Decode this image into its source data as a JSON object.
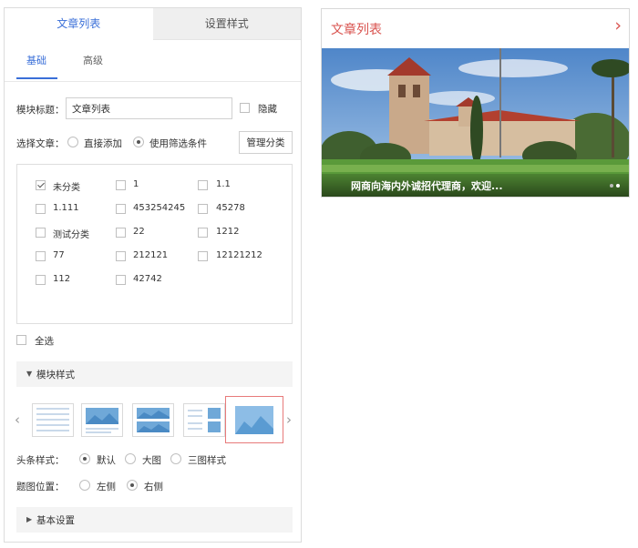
{
  "top_tabs": {
    "list": "文章列表",
    "style": "设置样式"
  },
  "sub_tabs": {
    "basic": "基础",
    "advanced": "高级"
  },
  "module_title": {
    "label": "模块标题：",
    "value": "文章列表",
    "hide_label": "隐藏"
  },
  "select_article": {
    "label": "选择文章：",
    "option_direct": "直接添加",
    "option_filter": "使用筛选条件",
    "manage_button": "管理分类"
  },
  "categories": [
    {
      "label": "未分类",
      "checked": true
    },
    {
      "label": "1",
      "checked": false
    },
    {
      "label": "1.1",
      "checked": false
    },
    {
      "label": "1.111",
      "checked": false
    },
    {
      "label": "453254245",
      "checked": false
    },
    {
      "label": "45278",
      "checked": false
    },
    {
      "label": "测试分类",
      "checked": false
    },
    {
      "label": "22",
      "checked": false
    },
    {
      "label": "1212",
      "checked": false
    },
    {
      "label": "77",
      "checked": false
    },
    {
      "label": "212121",
      "checked": false
    },
    {
      "label": "12121212",
      "checked": false
    },
    {
      "label": "112",
      "checked": false
    },
    {
      "label": "42742",
      "checked": false
    }
  ],
  "select_all": "全选",
  "module_style": {
    "title": "模块样式",
    "selected_index": 4
  },
  "headline_style": {
    "label": "头条样式：",
    "option_default": "默认",
    "option_large": "大图",
    "option_triple": "三图样式"
  },
  "title_position": {
    "label": "题图位置：",
    "option_left": "左侧",
    "option_right": "右侧"
  },
  "basic_settings": "基本设置",
  "preview": {
    "title": "文章列表",
    "caption": "网商向海内外诚招代理商，欢迎..."
  },
  "colors": {
    "accent": "#3a6fd8",
    "preview_red": "#d9534f",
    "selected_outline": "#e87a7a"
  }
}
